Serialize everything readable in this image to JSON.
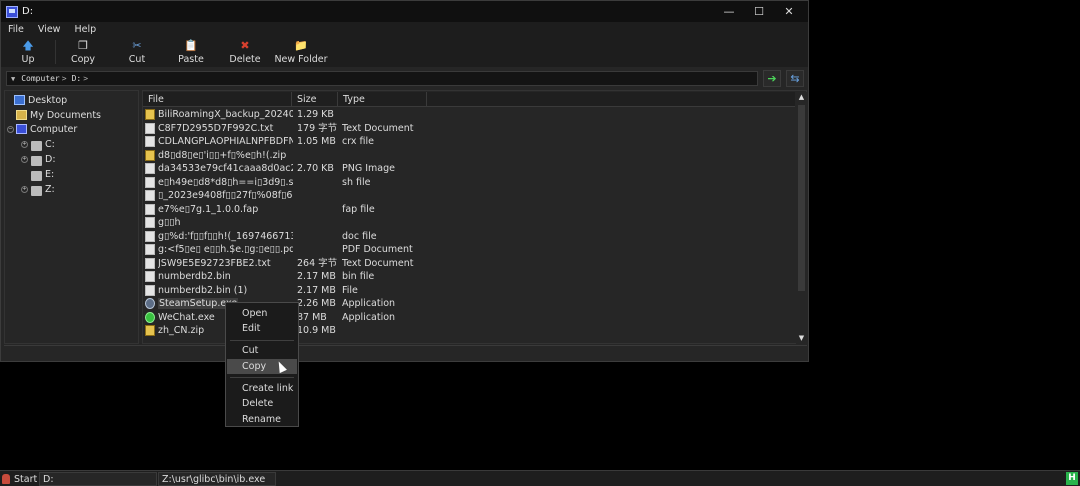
{
  "window": {
    "title": "D:",
    "controls": {
      "minimize": "—",
      "maximize": "☐",
      "close": "✕"
    }
  },
  "menu": [
    "File",
    "View",
    "Help"
  ],
  "toolbar": [
    {
      "label": "Up",
      "icon": "up-arrow-icon",
      "glyph": "🡅",
      "color": "#4a9ae8"
    },
    {
      "label": "Copy",
      "icon": "copy-icon",
      "glyph": "❐",
      "color": "#dddddd"
    },
    {
      "label": "Cut",
      "icon": "scissors-icon",
      "glyph": "✂",
      "color": "#6ea4e0"
    },
    {
      "label": "Paste",
      "icon": "paste-icon",
      "glyph": "📋",
      "color": "#e8c45a"
    },
    {
      "label": "Delete",
      "icon": "delete-x-icon",
      "glyph": "✖",
      "color": "#d8402e"
    },
    {
      "label": "New Folder",
      "icon": "new-folder-icon",
      "glyph": "📁",
      "color": "#e6c34e"
    }
  ],
  "address": {
    "crumbs": [
      "Computer",
      "D:"
    ]
  },
  "tree": {
    "items": [
      {
        "label": "Desktop",
        "icon": "desktop-icon"
      },
      {
        "label": "My Documents",
        "icon": "documents-icon"
      },
      {
        "label": "Computer",
        "icon": "computer-icon"
      },
      {
        "label": "C:",
        "icon": "drive-icon"
      },
      {
        "label": "D:",
        "icon": "drive-icon"
      },
      {
        "label": "E:",
        "icon": "drive-icon"
      },
      {
        "label": "Z:",
        "icon": "drive-icon"
      }
    ]
  },
  "filelist": {
    "columns": [
      "File",
      "Size",
      "Type"
    ],
    "rows": [
      {
        "name": "BiliRoamingX_backup_202404...",
        "size": "1.29 KB",
        "type": "",
        "icon": "zip"
      },
      {
        "name": "C8F7D2955D7F992C.txt",
        "size": "179 字节",
        "type": "Text Document",
        "icon": "doc"
      },
      {
        "name": "CDLANGPLAOPHIALNPFBDFN...",
        "size": "1.05 MB",
        "type": "crx file",
        "icon": "doc"
      },
      {
        "name": "d8▯d8▯e▯'i▯▯+f▯%e▯h!(.zip",
        "size": "",
        "type": "",
        "icon": "zip"
      },
      {
        "name": "da34533e79cf41caaa8d0ac20f...",
        "size": "2.70 KB",
        "type": "PNG Image",
        "icon": "doc"
      },
      {
        "name": "e▯h49e▯d8*d8▯h==i▯3d9▯.sh",
        "size": "",
        "type": "sh file",
        "icon": "doc"
      },
      {
        "name": "▯_2023e9408f▯▯27f▯%08f▯6...",
        "size": "",
        "type": "",
        "icon": "doc"
      },
      {
        "name": "e7%e▯7g.1_1.0.0.fap",
        "size": "",
        "type": "fap file",
        "icon": "doc"
      },
      {
        "name": "g▯▯h",
        "size": "",
        "type": "",
        "icon": "doc"
      },
      {
        "name": "g▯%d:'f▯▯f▯▯h!(_1697466713...",
        "size": "",
        "type": "doc file",
        "icon": "doc"
      },
      {
        "name": "g:<f5▯e▯ e▯▯h.$e.▯g:▯e▯▯.pdf",
        "size": "",
        "type": "PDF Document",
        "icon": "doc"
      },
      {
        "name": "JSW9E5E92723FBE2.txt",
        "size": "264 字节",
        "type": "Text Document",
        "icon": "doc"
      },
      {
        "name": "numberdb2.bin",
        "size": "2.17 MB",
        "type": "bin file",
        "icon": "doc"
      },
      {
        "name": "numberdb2.bin (1)",
        "size": "2.17 MB",
        "type": "File",
        "icon": "doc"
      },
      {
        "name": "SteamSetup.exe",
        "size": "2.26 MB",
        "type": "Application",
        "icon": "steam",
        "selected": true
      },
      {
        "name": "WeChat.exe",
        "size": "87 MB",
        "type": "Application",
        "icon": "wechat"
      },
      {
        "name": "zh_CN.zip",
        "size": "10.9 MB",
        "type": "",
        "icon": "zip"
      }
    ]
  },
  "context_menu": {
    "items": [
      {
        "label": "Open"
      },
      {
        "label": "Edit"
      },
      {
        "label": "Cut"
      },
      {
        "label": "Copy",
        "highlighted": true
      },
      {
        "label": "Create link"
      },
      {
        "label": "Delete"
      },
      {
        "label": "Rename"
      }
    ]
  },
  "taskbar": {
    "start_label": "Start",
    "tasks": [
      "D:",
      "Z:\\usr\\glibc\\bin\\ib.exe"
    ],
    "tray_icon": "H"
  }
}
